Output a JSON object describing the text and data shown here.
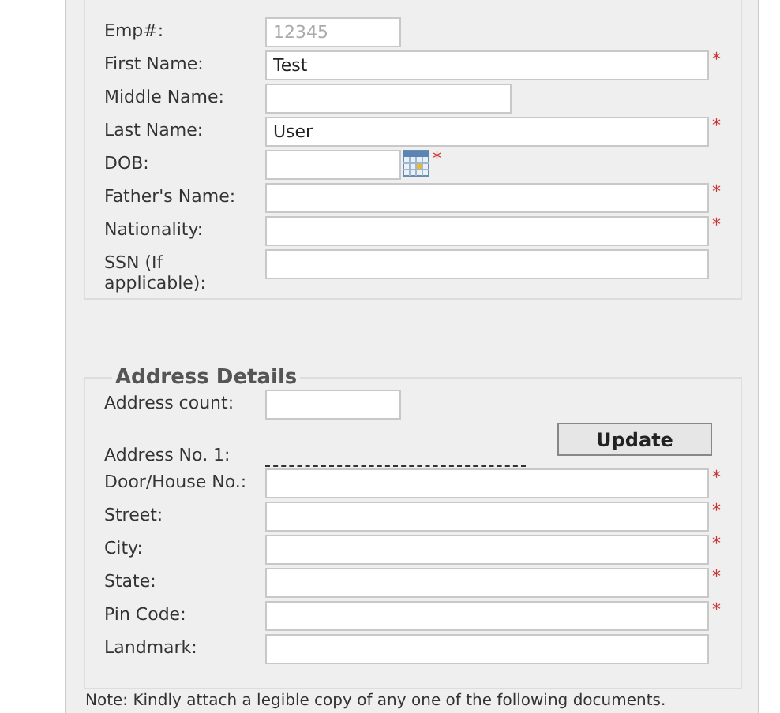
{
  "personal_fields": [
    {
      "label": "Emp#:",
      "kind": "short",
      "placeholder": "12345"
    },
    {
      "label": "First Name:",
      "kind": "wide",
      "value": "Test",
      "required_mark": "*"
    },
    {
      "label": "Middle Name:",
      "kind": "medium"
    },
    {
      "label": "Last Name:",
      "kind": "wide",
      "value": "User",
      "required_mark": "*"
    },
    {
      "label": "DOB:",
      "kind": "date",
      "required_mark": "*"
    },
    {
      "label": "Father's Name:",
      "kind": "wide",
      "required_mark": "*"
    },
    {
      "label": "Nationality:",
      "kind": "wide",
      "required_mark": "*"
    },
    {
      "label": "SSN (If applicable):",
      "kind": "wide"
    }
  ],
  "address": {
    "legend": "Address Details",
    "count_label": "Address count:",
    "update_button": "Update",
    "address_heading": "Address No. 1:",
    "fields": [
      {
        "label": "Door/House No.:",
        "required_mark": "*"
      },
      {
        "label": "Street:",
        "required_mark": "*"
      },
      {
        "label": "City:",
        "required_mark": "*"
      },
      {
        "label": "State:",
        "required_mark": "*"
      },
      {
        "label": "Pin Code:",
        "required_mark": "*"
      },
      {
        "label": "Landmark:"
      }
    ]
  },
  "note": "Note: Kindly attach a legible copy of any one of the following documents."
}
